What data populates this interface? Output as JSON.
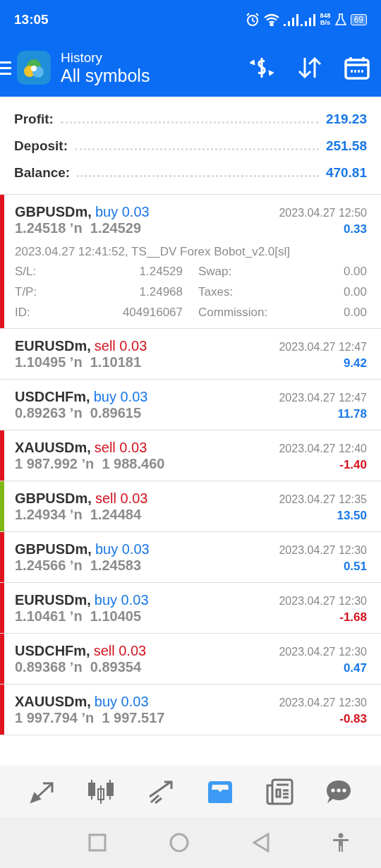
{
  "status_bar": {
    "time": "13:05",
    "net_speed": "848",
    "net_unit": "B/s",
    "battery": "69"
  },
  "header": {
    "subtitle": "History",
    "title": "All symbols"
  },
  "summary": [
    {
      "label": "Profit:",
      "value": "219.23"
    },
    {
      "label": "Deposit:",
      "value": "251.58"
    },
    {
      "label": "Balance:",
      "value": "470.81"
    }
  ],
  "deals": [
    {
      "symbol": "GBPUSDm,",
      "buy": true,
      "trade": "buy 0.03",
      "prices": "1.24518 ʼn  1.24529",
      "time": "2023.04.27 12:50",
      "profit": "0.33",
      "loss": false,
      "stop_loss_hit": true,
      "take_profit_hit": false,
      "expanded": true,
      "comment": "2023.04.27 12:41:52, TS__DV Forex Bobot_v2.0[sl]",
      "fields": [
        {
          "label": "S/L:",
          "value": "1.24529"
        },
        {
          "label": "Swap:",
          "value": "0.00"
        },
        {
          "label": "T/P:",
          "value": "1.24968"
        },
        {
          "label": "Taxes:",
          "value": "0.00"
        },
        {
          "label": "ID:",
          "value": "404916067"
        },
        {
          "label": "Commission:",
          "value": "0.00"
        }
      ]
    },
    {
      "symbol": "EURUSDm,",
      "buy": false,
      "trade": "sell 0.03",
      "prices": "1.10495 ʼn  1.10181",
      "time": "2023.04.27 12:47",
      "profit": "9.42",
      "loss": false,
      "stop_loss_hit": false,
      "take_profit_hit": false,
      "expanded": false
    },
    {
      "symbol": "USDCHFm,",
      "buy": true,
      "trade": "buy 0.03",
      "prices": "0.89263 ʼn  0.89615",
      "time": "2023.04.27 12:47",
      "profit": "11.78",
      "loss": false,
      "stop_loss_hit": false,
      "take_profit_hit": false,
      "expanded": false
    },
    {
      "symbol": "XAUUSDm,",
      "buy": false,
      "trade": "sell 0.03",
      "prices": "1 987.992 ʼn  1 988.460",
      "time": "2023.04.27 12:40",
      "profit": "-1.40",
      "loss": true,
      "stop_loss_hit": true,
      "take_profit_hit": false,
      "expanded": false
    },
    {
      "symbol": "GBPUSDm,",
      "buy": false,
      "trade": "sell 0.03",
      "prices": "1.24934 ʼn  1.24484",
      "time": "2023.04.27 12:35",
      "profit": "13.50",
      "loss": false,
      "stop_loss_hit": false,
      "take_profit_hit": true,
      "expanded": false
    },
    {
      "symbol": "GBPUSDm,",
      "buy": true,
      "trade": "buy 0.03",
      "prices": "1.24566 ʼn  1.24583",
      "time": "2023.04.27 12:30",
      "profit": "0.51",
      "loss": false,
      "stop_loss_hit": true,
      "take_profit_hit": false,
      "expanded": false
    },
    {
      "symbol": "EURUSDm,",
      "buy": true,
      "trade": "buy 0.03",
      "prices": "1.10461 ʼn  1.10405",
      "time": "2023.04.27 12:30",
      "profit": "-1.68",
      "loss": true,
      "stop_loss_hit": true,
      "take_profit_hit": false,
      "expanded": false
    },
    {
      "symbol": "USDCHFm,",
      "buy": false,
      "trade": "sell 0.03",
      "prices": "0.89368 ʼn  0.89354",
      "time": "2023.04.27 12:30",
      "profit": "0.47",
      "loss": false,
      "stop_loss_hit": true,
      "take_profit_hit": false,
      "expanded": false
    },
    {
      "symbol": "XAUUSDm,",
      "buy": true,
      "trade": "buy 0.03",
      "prices": "1 997.794 ʼn  1 997.517",
      "time": "2023.04.27 12:30",
      "profit": "-0.83",
      "loss": true,
      "stop_loss_hit": true,
      "take_profit_hit": false,
      "expanded": false
    }
  ],
  "bottom_nav": [
    {
      "selected": false
    },
    {
      "selected": false
    },
    {
      "selected": false
    },
    {
      "selected": true
    },
    {
      "selected": false
    },
    {
      "selected": false
    }
  ]
}
